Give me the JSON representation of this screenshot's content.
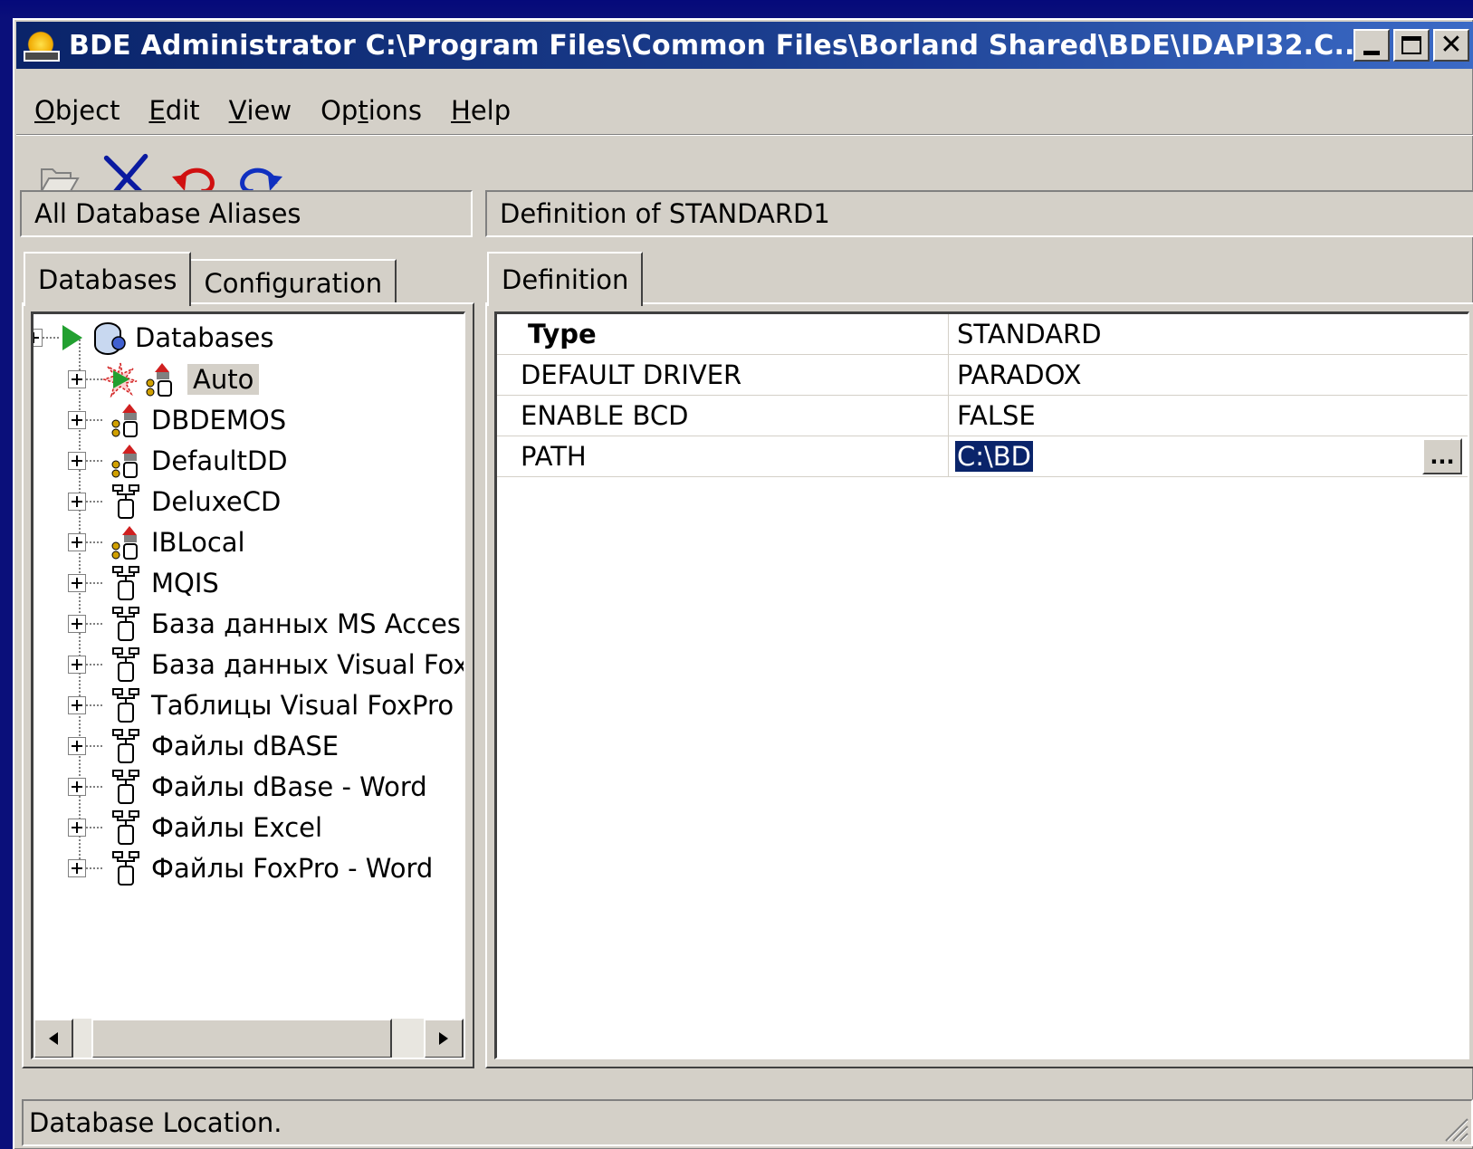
{
  "window": {
    "title": "BDE Administrator  C:\\Program Files\\Common Files\\Borland Shared\\BDE\\IDAPI32.C..."
  },
  "menu": [
    {
      "label_pre": "",
      "label_ul": "O",
      "label_post": "bject"
    },
    {
      "label_pre": "",
      "label_ul": "E",
      "label_post": "dit"
    },
    {
      "label_pre": "",
      "label_ul": "V",
      "label_post": "iew"
    },
    {
      "label_pre": "Op",
      "label_ul": "t",
      "label_post": "ions"
    },
    {
      "label_pre": "",
      "label_ul": "H",
      "label_post": "elp"
    }
  ],
  "toolbar": {
    "icons": [
      "open-folder-icon",
      "delete-x-icon",
      "undo-icon",
      "redo-icon"
    ]
  },
  "left_panel": {
    "header": "All Database Aliases",
    "tabs": [
      "Databases",
      "Configuration"
    ],
    "root": "Databases",
    "items": [
      {
        "label": "Auto",
        "icon": "alias-active-icon"
      },
      {
        "label": "DBDEMOS",
        "icon": "paradox-alias-icon"
      },
      {
        "label": "DefaultDD",
        "icon": "paradox-alias-icon"
      },
      {
        "label": "DeluxeCD",
        "icon": "odbc-alias-icon"
      },
      {
        "label": "IBLocal",
        "icon": "paradox-alias-icon"
      },
      {
        "label": "MQIS",
        "icon": "odbc-alias-icon"
      },
      {
        "label": "База данных MS Acces:",
        "icon": "odbc-alias-icon"
      },
      {
        "label": "База данных Visual FoxF",
        "icon": "odbc-alias-icon"
      },
      {
        "label": "Таблицы Visual FoxPro",
        "icon": "odbc-alias-icon"
      },
      {
        "label": "Файлы dBASE",
        "icon": "odbc-alias-icon"
      },
      {
        "label": "Файлы dBase - Word",
        "icon": "odbc-alias-icon"
      },
      {
        "label": "Файлы Excel",
        "icon": "odbc-alias-icon"
      },
      {
        "label": "Файлы FoxPro - Word",
        "icon": "odbc-alias-icon"
      }
    ]
  },
  "right_panel": {
    "header": "Definition of STANDARD1",
    "tab": "Definition",
    "rows": [
      {
        "name": "Type",
        "value": "STANDARD",
        "bold": true
      },
      {
        "name": "DEFAULT DRIVER",
        "value": "PARADOX"
      },
      {
        "name": "ENABLE BCD",
        "value": "FALSE"
      },
      {
        "name": "PATH",
        "value": "C:\\BD",
        "selected": true,
        "ellipsis": "..."
      }
    ]
  },
  "status": {
    "text": "Database Location."
  },
  "colors": {
    "titlebar": "#0a246a",
    "face": "#d4d0c8",
    "selection": "#0a246a",
    "desktop": "#0a0f7a"
  }
}
